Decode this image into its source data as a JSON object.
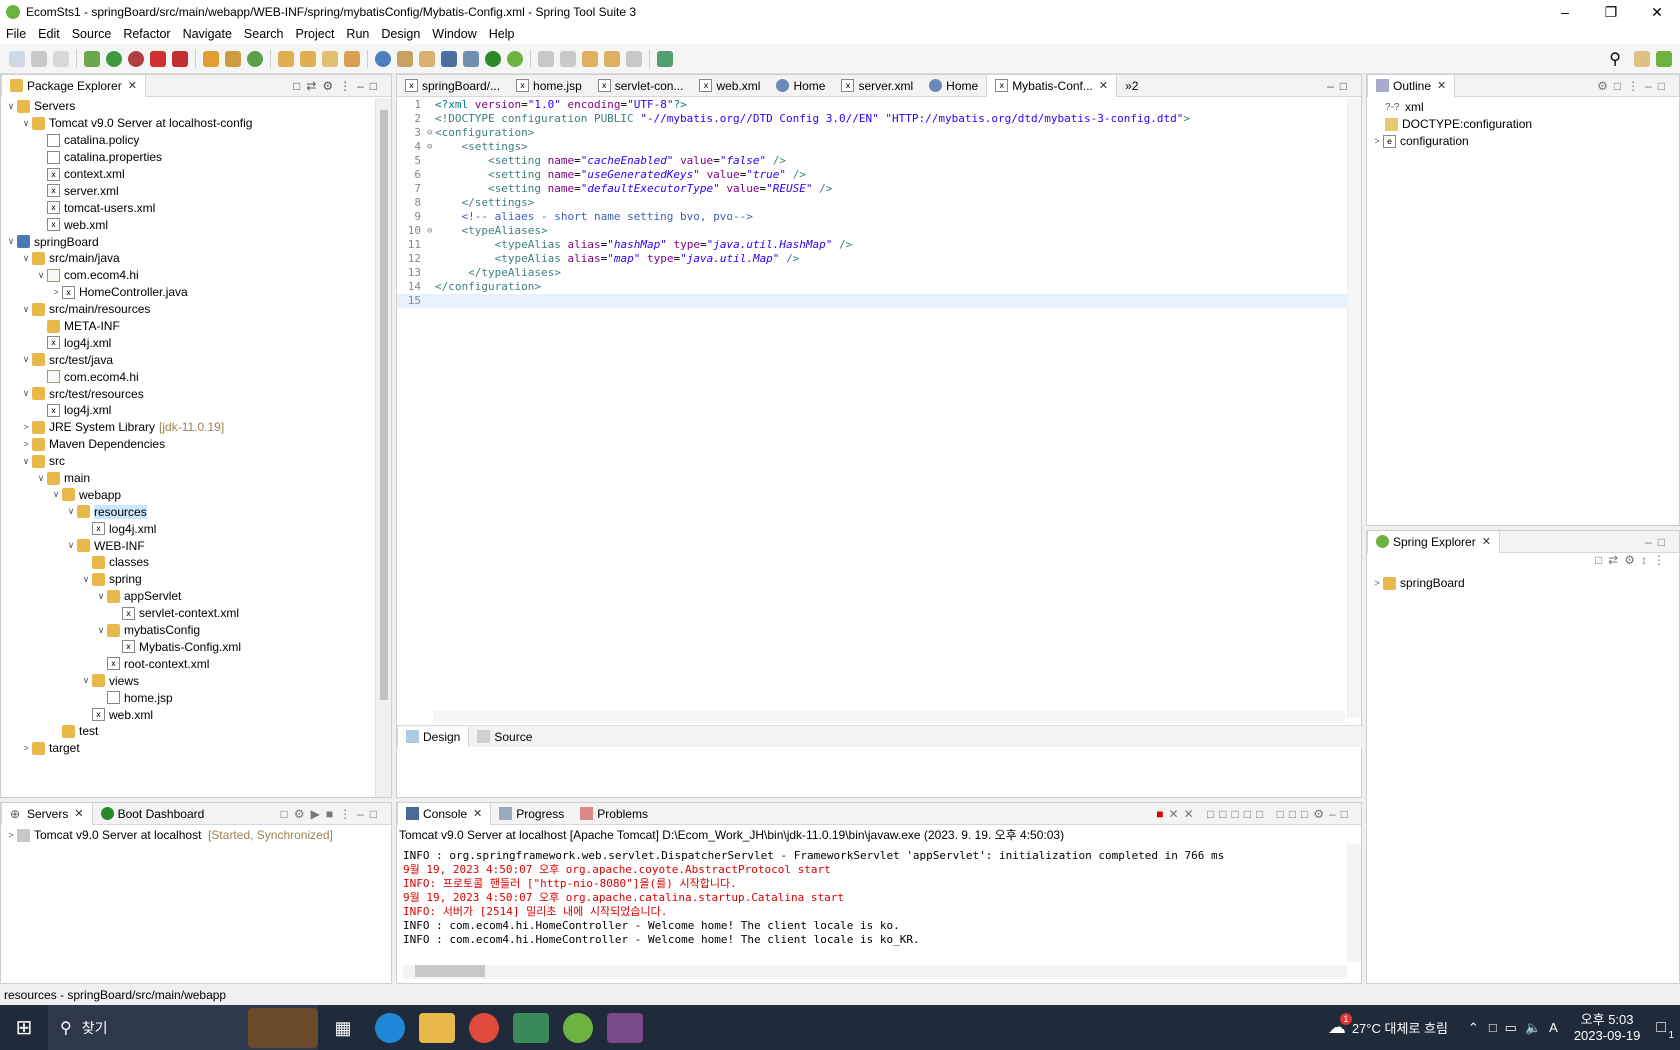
{
  "window": {
    "title": "EcomSts1 - springBoard/src/main/webapp/WEB-INF/spring/mybatisConfig/Mybatis-Config.xml - Spring Tool Suite 3"
  },
  "menu": [
    "File",
    "Edit",
    "Source",
    "Refactor",
    "Navigate",
    "Search",
    "Project",
    "Run",
    "Design",
    "Window",
    "Help"
  ],
  "package_explorer": {
    "tab_label": "Package Explorer",
    "tree": [
      {
        "d": 0,
        "tw": "v",
        "icon": "folder",
        "label": "Servers"
      },
      {
        "d": 1,
        "tw": "v",
        "icon": "folder",
        "label": "Tomcat v9.0 Server at localhost-config"
      },
      {
        "d": 2,
        "tw": "",
        "icon": "file",
        "label": "catalina.policy"
      },
      {
        "d": 2,
        "tw": "",
        "icon": "file",
        "label": "catalina.properties"
      },
      {
        "d": 2,
        "tw": "",
        "icon": "filex",
        "label": "context.xml"
      },
      {
        "d": 2,
        "tw": "",
        "icon": "filex",
        "label": "server.xml"
      },
      {
        "d": 2,
        "tw": "",
        "icon": "filex",
        "label": "tomcat-users.xml"
      },
      {
        "d": 2,
        "tw": "",
        "icon": "filex",
        "label": "web.xml"
      },
      {
        "d": 0,
        "tw": "v",
        "icon": "proj",
        "label": "springBoard"
      },
      {
        "d": 1,
        "tw": "v",
        "icon": "folder",
        "label": "src/main/java"
      },
      {
        "d": 2,
        "tw": "v",
        "icon": "pkg",
        "label": "com.ecom4.hi"
      },
      {
        "d": 3,
        "tw": ">",
        "icon": "filex",
        "label": "HomeController.java"
      },
      {
        "d": 1,
        "tw": "v",
        "icon": "folder",
        "label": "src/main/resources"
      },
      {
        "d": 2,
        "tw": "",
        "icon": "folder",
        "label": "META-INF"
      },
      {
        "d": 2,
        "tw": "",
        "icon": "filex",
        "label": "log4j.xml"
      },
      {
        "d": 1,
        "tw": "v",
        "icon": "folder",
        "label": "src/test/java"
      },
      {
        "d": 2,
        "tw": "",
        "icon": "pkg",
        "label": "com.ecom4.hi"
      },
      {
        "d": 1,
        "tw": "v",
        "icon": "folder",
        "label": "src/test/resources"
      },
      {
        "d": 2,
        "tw": "",
        "icon": "filex",
        "label": "log4j.xml"
      },
      {
        "d": 1,
        "tw": ">",
        "icon": "folder",
        "label": "JRE System Library",
        "deco": "[jdk-11.0.19]"
      },
      {
        "d": 1,
        "tw": ">",
        "icon": "folder",
        "label": "Maven Dependencies"
      },
      {
        "d": 1,
        "tw": "v",
        "icon": "folder",
        "label": "src"
      },
      {
        "d": 2,
        "tw": "v",
        "icon": "folder",
        "label": "main"
      },
      {
        "d": 3,
        "tw": "v",
        "icon": "folder",
        "label": "webapp"
      },
      {
        "d": 4,
        "tw": "v",
        "icon": "folder",
        "label": "resources",
        "selected": true
      },
      {
        "d": 5,
        "tw": "",
        "icon": "filex",
        "label": "log4j.xml"
      },
      {
        "d": 4,
        "tw": "v",
        "icon": "folder",
        "label": "WEB-INF"
      },
      {
        "d": 5,
        "tw": "",
        "icon": "folder",
        "label": "classes"
      },
      {
        "d": 5,
        "tw": "v",
        "icon": "folder",
        "label": "spring"
      },
      {
        "d": 6,
        "tw": "v",
        "icon": "folder",
        "label": "appServlet"
      },
      {
        "d": 7,
        "tw": "",
        "icon": "filex",
        "label": "servlet-context.xml"
      },
      {
        "d": 6,
        "tw": "v",
        "icon": "folder",
        "label": "mybatisConfig"
      },
      {
        "d": 7,
        "tw": "",
        "icon": "filex",
        "label": "Mybatis-Config.xml"
      },
      {
        "d": 6,
        "tw": "",
        "icon": "filex",
        "label": "root-context.xml"
      },
      {
        "d": 5,
        "tw": "v",
        "icon": "folder",
        "label": "views"
      },
      {
        "d": 6,
        "tw": "",
        "icon": "file",
        "label": "home.jsp"
      },
      {
        "d": 5,
        "tw": "",
        "icon": "filex",
        "label": "web.xml"
      },
      {
        "d": 3,
        "tw": "",
        "icon": "folder",
        "label": "test"
      },
      {
        "d": 1,
        "tw": ">",
        "icon": "folder",
        "label": "target"
      }
    ]
  },
  "servers_panel": {
    "tabs": [
      "Servers",
      "Boot Dashboard"
    ],
    "rows": [
      {
        "label": "Tomcat v9.0 Server at localhost",
        "status": "[Started, Synchronized]"
      }
    ]
  },
  "editor": {
    "tabs": [
      "springBoard/...",
      "home.jsp",
      "servlet-con...",
      "web.xml",
      "Home",
      "server.xml",
      "Home",
      "Mybatis-Conf...",
      "»2"
    ],
    "active_tab": "Mybatis-Conf...",
    "bottom_tabs": [
      "Design",
      "Source"
    ],
    "lines": [
      "1",
      "2",
      "3",
      "4",
      "5",
      "6",
      "7",
      "8",
      "9",
      "10",
      "11",
      "12",
      "13",
      "14",
      "15"
    ]
  },
  "outline": {
    "tab_label": "Outline",
    "items": [
      {
        "icon": "?-?",
        "label": "xml"
      },
      {
        "icon": "doc",
        "label": "DOCTYPE:configuration"
      },
      {
        "icon": "e",
        "label": "configuration"
      }
    ]
  },
  "spring_explorer": {
    "tab_label": "Spring Explorer",
    "items": [
      "springBoard"
    ]
  },
  "console": {
    "tabs": [
      "Console",
      "Progress",
      "Problems"
    ],
    "header": "Tomcat v9.0 Server at localhost [Apache Tomcat] D:\\Ecom_Work_JH\\bin\\jdk-11.0.19\\bin\\javaw.exe  (2023. 9. 19. 오후 4:50:03)",
    "lines": [
      {
        "text": "INFO : org.springframework.web.servlet.DispatcherServlet - FrameworkServlet 'appServlet': initialization completed in 766 ms",
        "red": false
      },
      {
        "text": "9월 19, 2023 4:50:07 오후 org.apache.coyote.AbstractProtocol start",
        "red": true
      },
      {
        "text": "INFO: 프로토콜 핸들러 [\"http-nio-8080\"]을(를) 시작합니다.",
        "red": true
      },
      {
        "text": "9월 19, 2023 4:50:07 오후 org.apache.catalina.startup.Catalina start",
        "red": true
      },
      {
        "text": "INFO: 서버가 [2514] 밀리초 내에 시작되었습니다.",
        "red": true
      },
      {
        "text": "INFO : com.ecom4.hi.HomeController - Welcome home! The client locale is ko.",
        "red": false
      },
      {
        "text": "INFO : com.ecom4.hi.HomeController - Welcome home! The client locale is ko_KR.",
        "red": false
      }
    ]
  },
  "status_bar": {
    "text": "resources - springBoard/src/main/webapp"
  },
  "taskbar": {
    "search_label": "찾기",
    "weather": "27°C 대체로 흐림",
    "ime": "A",
    "time": "오후 5:03",
    "date": "2023-09-19",
    "notif_count": "1",
    "weather_badge": "1"
  }
}
